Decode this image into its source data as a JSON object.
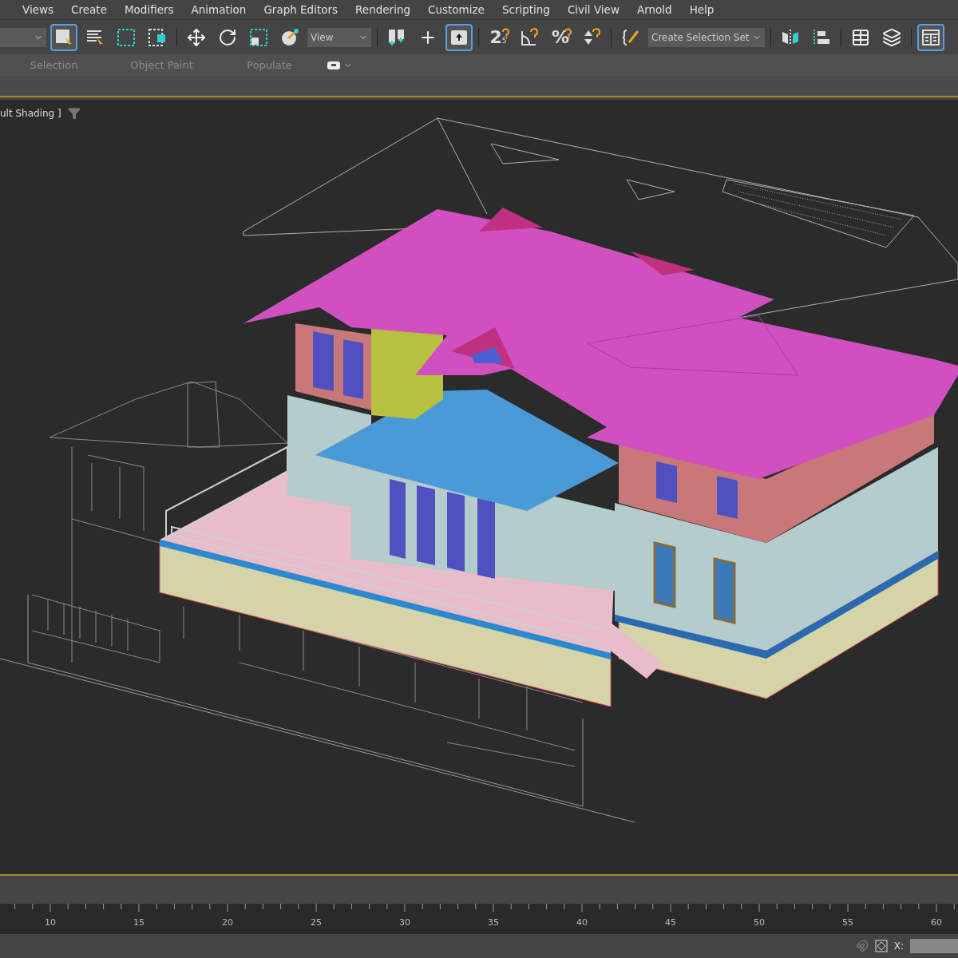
{
  "menu_bar": {
    "items": [
      "Views",
      "Create",
      "Modifiers",
      "Animation",
      "Graph Editors",
      "Rendering",
      "Customize",
      "Scripting",
      "Civil View",
      "Arnold",
      "Help"
    ]
  },
  "toolbar": {
    "items": [
      {
        "kind": "dropdown"
      },
      {
        "kind": "button",
        "selected": true
      },
      {
        "kind": "button",
        "selected": false
      },
      {
        "kind": "button",
        "selected": false
      },
      {
        "kind": "button",
        "selected": false
      },
      {
        "kind": "button",
        "selected": false
      },
      {
        "kind": "button",
        "selected": false
      },
      {
        "kind": "button",
        "selected": false
      },
      {
        "kind": "button",
        "selected": false
      },
      {
        "kind": "dropdown",
        "value": "View"
      },
      {
        "kind": "button",
        "selected": false
      },
      {
        "kind": "button",
        "selected": false
      },
      {
        "kind": "button",
        "selected": true
      },
      {
        "kind": "button",
        "selected": false,
        "label": "2",
        "sub": "5"
      },
      {
        "kind": "button",
        "selected": false
      },
      {
        "kind": "button",
        "selected": false,
        "label": "%"
      },
      {
        "kind": "button",
        "selected": false
      },
      {
        "kind": "button",
        "selected": false
      },
      {
        "kind": "dropdown",
        "value": "Create Selection Set"
      },
      {
        "kind": "button",
        "selected": false
      },
      {
        "kind": "button",
        "selected": false
      },
      {
        "kind": "button",
        "selected": false
      },
      {
        "kind": "button",
        "selected": false
      },
      {
        "kind": "button",
        "selected": true
      }
    ]
  },
  "ribbon": {
    "tabs": [
      "Selection",
      "Object Paint",
      "Populate"
    ]
  },
  "viewport": {
    "label": "ult Shading ]"
  },
  "timeline": {
    "labels": [
      "10",
      "15",
      "20",
      "25",
      "30",
      "35",
      "40",
      "45",
      "50",
      "55",
      "60"
    ]
  },
  "status_bar": {
    "coordinate_label": "X:"
  }
}
